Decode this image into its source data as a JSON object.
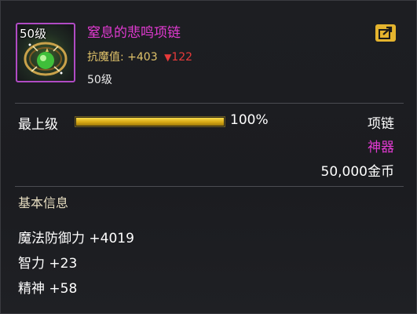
{
  "item": {
    "icon_level": "50级",
    "icon_name": "necklace-icon",
    "name": "窒息的悲鸣项链",
    "resist_label": "抗魔值:",
    "resist_value": "+403",
    "resist_arrow": "▼",
    "resist_diff": "122",
    "required_level": "50级"
  },
  "grade": {
    "label": "最上级",
    "percent_text": "100%",
    "fill_fraction": 1.0
  },
  "meta": {
    "type": "项链",
    "rarity": "神器",
    "price": "50,000金币"
  },
  "basic_info": {
    "title": "基本信息",
    "stats": [
      "魔法防御力 +4019",
      "智力 +23",
      "精神 +58"
    ]
  },
  "colors": {
    "rarity_purple": "#e23ad2",
    "resist_gold": "#e0c36a",
    "decrease_red": "#e83a3a",
    "share_button_gold": "#e4b42e"
  }
}
